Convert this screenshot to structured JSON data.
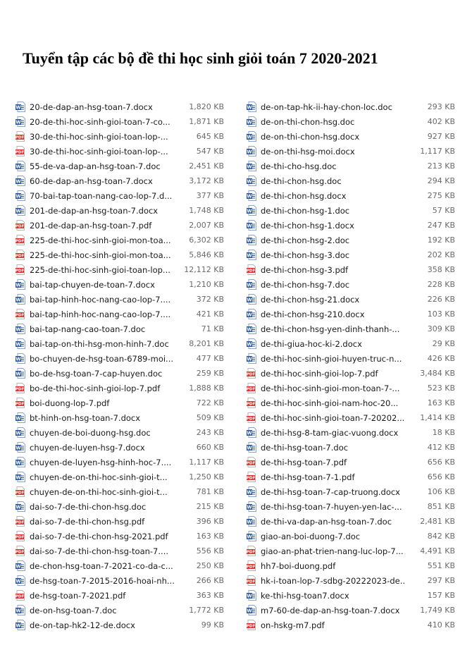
{
  "title": "Tuyển tập các bộ đề thi học sinh giỏi toán 7 2020-2021",
  "colors": {
    "word": "#2b579a",
    "pdf": "#d9342b"
  },
  "left": [
    {
      "name": "20-de-dap-an-hsg-toan-7.docx",
      "size": "1,820 KB",
      "type": "word"
    },
    {
      "name": "20-de-thi-hoc-sinh-gioi-toan-7-co...",
      "size": "1,871 KB",
      "type": "word"
    },
    {
      "name": "30-de-thi-hoc-sinh-gioi-toan-lop-...",
      "size": "645 KB",
      "type": "pdf"
    },
    {
      "name": "30-de-thi-hoc-sinh-gioi-toan-lop-...",
      "size": "547 KB",
      "type": "pdf"
    },
    {
      "name": "55-de-va-dap-an-hsg-toan-7.doc",
      "size": "2,451 KB",
      "type": "word"
    },
    {
      "name": "60-de-dap-an-hsg-toan-7.docx",
      "size": "3,172 KB",
      "type": "word"
    },
    {
      "name": "70-bai-tap-toan-nang-cao-lop-7.d...",
      "size": "377 KB",
      "type": "word"
    },
    {
      "name": "201-de-dap-an-hsg-toan-7.docx",
      "size": "1,748 KB",
      "type": "word"
    },
    {
      "name": "201-de-dap-an-hsg-toan-7.pdf",
      "size": "2,007 KB",
      "type": "pdf"
    },
    {
      "name": "225-de-thi-hoc-sinh-gioi-mon-toa...",
      "size": "6,302 KB",
      "type": "pdf"
    },
    {
      "name": "225-de-thi-hoc-sinh-gioi-mon-toa...",
      "size": "5,846 KB",
      "type": "pdf"
    },
    {
      "name": "225-de-thi-hoc-sinh-gioi-toan-lop...",
      "size": "12,112 KB",
      "type": "pdf"
    },
    {
      "name": "bai-tap-chuyen-de-toan-7.docx",
      "size": "1,210 KB",
      "type": "word"
    },
    {
      "name": "bai-tap-hinh-hoc-nang-cao-lop-7....",
      "size": "372 KB",
      "type": "word"
    },
    {
      "name": "bai-tap-hinh-hoc-nang-cao-lop-7....",
      "size": "421 KB",
      "type": "pdf"
    },
    {
      "name": "bai-tap-nang-cao-toan-7.doc",
      "size": "71 KB",
      "type": "word"
    },
    {
      "name": "bai-tap-on-thi-hsg-mon-hinh-7.doc",
      "size": "8,201 KB",
      "type": "word"
    },
    {
      "name": "bo-chuyen-de-hsg-toan-6789-moi...",
      "size": "477 KB",
      "type": "word"
    },
    {
      "name": "bo-de-hsg-toan-7-cap-huyen.doc",
      "size": "259 KB",
      "type": "word"
    },
    {
      "name": "bo-de-thi-hoc-sinh-gioi-lop-7.pdf",
      "size": "1,888 KB",
      "type": "pdf"
    },
    {
      "name": "boi-duong-lop-7.pdf",
      "size": "722 KB",
      "type": "pdf"
    },
    {
      "name": "bt-hinh-on-hsg-toan-7.docx",
      "size": "509 KB",
      "type": "word"
    },
    {
      "name": "chuyen-de-boi-duong-hsg.doc",
      "size": "243 KB",
      "type": "word"
    },
    {
      "name": "chuyen-de-luyen-hsg-7.docx",
      "size": "660 KB",
      "type": "word"
    },
    {
      "name": "chuyen-de-luyen-hsg-hinh-hoc-7....",
      "size": "1,117 KB",
      "type": "word"
    },
    {
      "name": "chuyen-de-on-thi-hoc-sinh-gioi-t...",
      "size": "1,250 KB",
      "type": "word"
    },
    {
      "name": "chuyen-de-on-thi-hoc-sinh-gioi-t...",
      "size": "781 KB",
      "type": "pdf"
    },
    {
      "name": "dai-so-7-de-thi-chon-hsg.doc",
      "size": "215 KB",
      "type": "word"
    },
    {
      "name": "dai-so-7-de-thi-chon-hsg.pdf",
      "size": "396 KB",
      "type": "pdf"
    },
    {
      "name": "dai-so-7-de-thi-chon-hsg-2021.pdf",
      "size": "163 KB",
      "type": "pdf"
    },
    {
      "name": "dai-so-7-de-thi-chon-hsg-toan-7....",
      "size": "556 KB",
      "type": "pdf"
    },
    {
      "name": "de-chon-hsg-toan-7-2021-co-da-c...",
      "size": "250 KB",
      "type": "word"
    },
    {
      "name": "de-hsg-toan-7-2015-2016-hoai-nh...",
      "size": "266 KB",
      "type": "word"
    },
    {
      "name": "de-hsg-toan-7-2021.pdf",
      "size": "363 KB",
      "type": "pdf"
    },
    {
      "name": "de-on-hsg-toan-7.doc",
      "size": "1,772 KB",
      "type": "word"
    },
    {
      "name": "de-on-tap-hk2-12-de.docx",
      "size": "99 KB",
      "type": "word"
    }
  ],
  "right": [
    {
      "name": "de-on-tap-hk-ii-hay-chon-loc.doc",
      "size": "293 KB",
      "type": "word"
    },
    {
      "name": "de-on-thi-chon-hsg.doc",
      "size": "402 KB",
      "type": "word"
    },
    {
      "name": "de-on-thi-chon-hsg.docx",
      "size": "927 KB",
      "type": "word"
    },
    {
      "name": "de-on-thi-hsg-moi.docx",
      "size": "1,117 KB",
      "type": "word"
    },
    {
      "name": "de-thi-cho-hsg.doc",
      "size": "213 KB",
      "type": "word"
    },
    {
      "name": "de-thi-chon-hsg.doc",
      "size": "294 KB",
      "type": "word"
    },
    {
      "name": "de-thi-chon-hsg.docx",
      "size": "275 KB",
      "type": "word"
    },
    {
      "name": "de-thi-chon-hsg-1.doc",
      "size": "57 KB",
      "type": "word"
    },
    {
      "name": "de-thi-chon-hsg-1.docx",
      "size": "247 KB",
      "type": "word"
    },
    {
      "name": "de-thi-chon-hsg-2.doc",
      "size": "192 KB",
      "type": "word"
    },
    {
      "name": "de-thi-chon-hsg-3.doc",
      "size": "202 KB",
      "type": "word"
    },
    {
      "name": "de-thi-chon-hsg-3.pdf",
      "size": "358 KB",
      "type": "pdf"
    },
    {
      "name": "de-thi-chon-hsg-7.doc",
      "size": "228 KB",
      "type": "word"
    },
    {
      "name": "de-thi-chon-hsg-21.docx",
      "size": "226 KB",
      "type": "word"
    },
    {
      "name": "de-thi-chon-hsg-210.docx",
      "size": "103 KB",
      "type": "word"
    },
    {
      "name": "de-thi-chon-hsg-yen-dinh-thanh-...",
      "size": "309 KB",
      "type": "word"
    },
    {
      "name": "de-thi-giua-hoc-ki-2.docx",
      "size": "29 KB",
      "type": "word"
    },
    {
      "name": "de-thi-hoc-sinh-gioi-huyen-truc-n...",
      "size": "426 KB",
      "type": "word"
    },
    {
      "name": "de-thi-hoc-sinh-gioi-lop-7.pdf",
      "size": "3,484 KB",
      "type": "pdf"
    },
    {
      "name": "de-thi-hoc-sinh-gioi-mon-toan-7-...",
      "size": "523 KB",
      "type": "pdf"
    },
    {
      "name": "de-thi-hoc-sinh-gioi-nam-hoc-20...",
      "size": "163 KB",
      "type": "pdf"
    },
    {
      "name": "de-thi-hoc-sinh-gioi-toan-7-20202...",
      "size": "1,414 KB",
      "type": "pdf"
    },
    {
      "name": "de-thi-hsg-8-tam-giac-vuong.docx",
      "size": "18 KB",
      "type": "word"
    },
    {
      "name": "de-thi-hsg-toan-7.doc",
      "size": "412 KB",
      "type": "word"
    },
    {
      "name": "de-thi-hsg-toan-7.pdf",
      "size": "656 KB",
      "type": "pdf"
    },
    {
      "name": "de-thi-hsg-toan-7-1.pdf",
      "size": "656 KB",
      "type": "pdf"
    },
    {
      "name": "de-thi-hsg-toan-7-cap-truong.docx",
      "size": "106 KB",
      "type": "word"
    },
    {
      "name": "de-thi-hsg-toan-7-huyen-yen-lac-...",
      "size": "851 KB",
      "type": "word"
    },
    {
      "name": "de-thi-va-dap-an-hsg-toan-7.doc",
      "size": "2,481 KB",
      "type": "word"
    },
    {
      "name": "giao-an-boi-duong-7.doc",
      "size": "842 KB",
      "type": "word"
    },
    {
      "name": "giao-an-phat-trien-nang-luc-lop-7...",
      "size": "4,491 KB",
      "type": "pdf"
    },
    {
      "name": "hh7-boi-duong.pdf",
      "size": "551 KB",
      "type": "pdf"
    },
    {
      "name": "hk-i-toan-lop-7-sdbg-20222023-de...",
      "size": "297 KB",
      "type": "pdf"
    },
    {
      "name": "ke-thi-hsg-toan7.docx",
      "size": "157 KB",
      "type": "word"
    },
    {
      "name": "m7-60-de-dap-an-hsg-toan-7.docx",
      "size": "1,749 KB",
      "type": "word"
    },
    {
      "name": "on-hskg-m7.pdf",
      "size": "410 KB",
      "type": "pdf"
    }
  ]
}
